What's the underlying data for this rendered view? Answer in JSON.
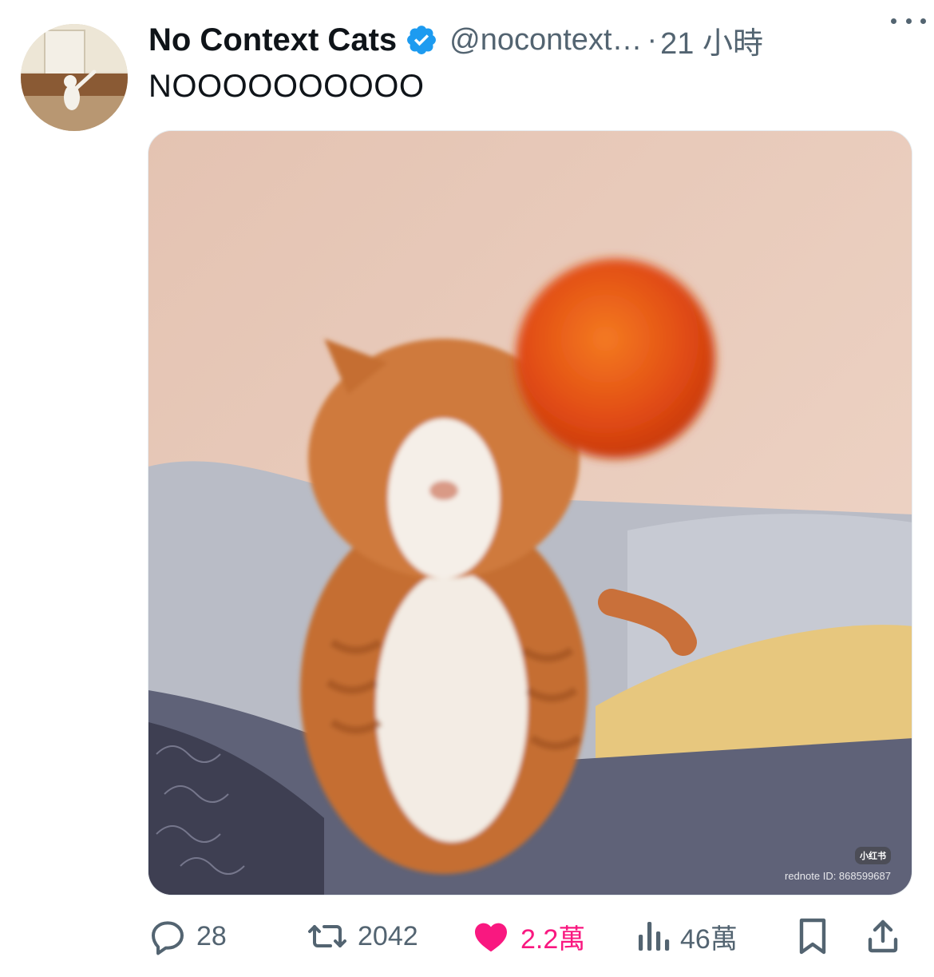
{
  "tweet": {
    "display_name": "No Context Cats",
    "handle": "@nocontext…",
    "separator": "·",
    "time": "21 小時",
    "text": "NOOOOOOOOOO",
    "verified": true
  },
  "media": {
    "watermark_badge": "小红书",
    "watermark_id": "rednote ID: 868599687"
  },
  "actions": {
    "reply_count": "28",
    "retweet_count": "2042",
    "like_count": "2.2萬",
    "views_count": "46萬",
    "liked": true
  },
  "icons": {
    "verified": "verified-badge-icon",
    "more": "more-dots-icon",
    "reply": "reply-icon",
    "retweet": "retweet-icon",
    "like": "heart-icon",
    "views": "views-icon",
    "bookmark": "bookmark-icon",
    "share": "share-icon"
  },
  "colors": {
    "text_primary": "#0f1419",
    "text_secondary": "#536471",
    "verified_blue": "#1d9bf0",
    "like_pink": "#f91880"
  }
}
